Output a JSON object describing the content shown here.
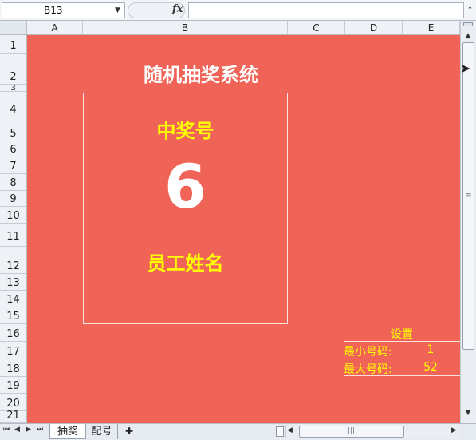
{
  "formula_bar": {
    "name_box": "B13",
    "fx_label": "fx",
    "formula": ""
  },
  "columns": [
    "A",
    "B",
    "C",
    "D",
    "E"
  ],
  "rows": [
    "1",
    "2",
    "3",
    "4",
    "5",
    "6",
    "7",
    "8",
    "9",
    "10",
    "11",
    "12",
    "13",
    "14",
    "15",
    "16",
    "17",
    "18",
    "19",
    "20",
    "21"
  ],
  "sheet": {
    "title": "随机抽奖系统",
    "prize_label": "中奖号",
    "prize_number": "6",
    "employee_name": "员工姓名",
    "settings": {
      "title": "设置",
      "min_label": "最小号码:",
      "min_value": "1",
      "max_label": "最大号码:",
      "max_value": "52"
    }
  },
  "tabs": [
    "抽奖",
    "配号"
  ],
  "colors": {
    "sheet_background": "#f06458",
    "highlight_text": "#ffff00",
    "white_text": "#ffffff"
  },
  "icons": [
    "dropdown-arrow-icon",
    "fx-icon",
    "expand-formula-icon",
    "scroll-up-icon",
    "scroll-down-icon",
    "mouse-cursor-icon",
    "first-sheet-icon",
    "prev-sheet-icon",
    "next-sheet-icon",
    "last-sheet-icon",
    "new-sheet-icon"
  ]
}
